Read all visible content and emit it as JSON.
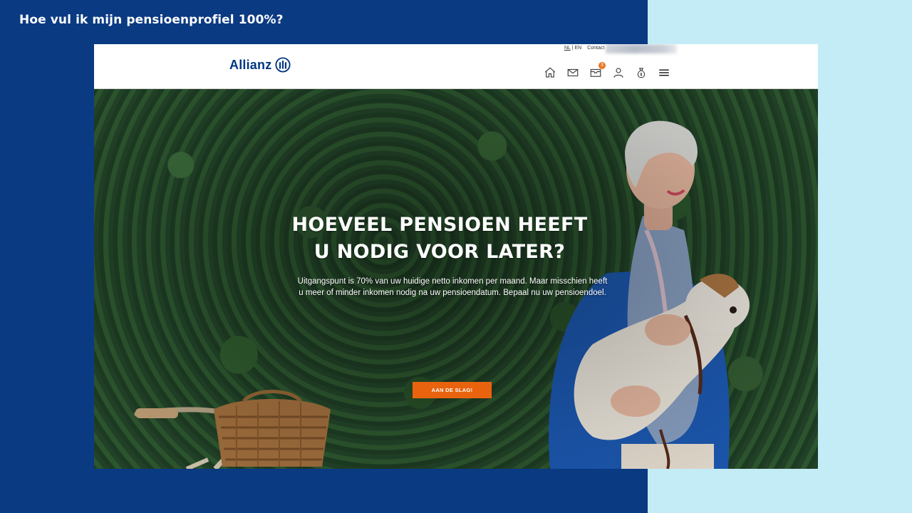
{
  "video": {
    "title": "Hoe vul ik mijn pensioenprofiel 100%?"
  },
  "site": {
    "logo_text": "Allianz",
    "top_links": {
      "lang_nl": "NL",
      "lang_separator": "|",
      "lang_en": "EN",
      "contact": "Contact"
    },
    "nav_icons": [
      "home-icon",
      "mail-icon",
      "inbox-icon",
      "user-icon",
      "money-bag-icon",
      "menu-icon"
    ],
    "inbox_badge": "3"
  },
  "hero": {
    "title_line1": "HOEVEEL PENSIOEN HEEFT",
    "title_line2": "U NODIG VOOR LATER?",
    "description": "Uitgangspunt is 70% van uw huidige netto inkomen per maand. Maar misschien heeft u meer of minder inkomen nodig na uw pensioendatum. Bepaal nu uw pensioendoel.",
    "cta_label": "AAN DE SLAG!"
  },
  "colors": {
    "brand_blue": "#003781",
    "background_dark": "#0a3a82",
    "background_light": "#c3ecf6",
    "cta_orange": "#e9630f",
    "badge_orange": "#e87722"
  }
}
